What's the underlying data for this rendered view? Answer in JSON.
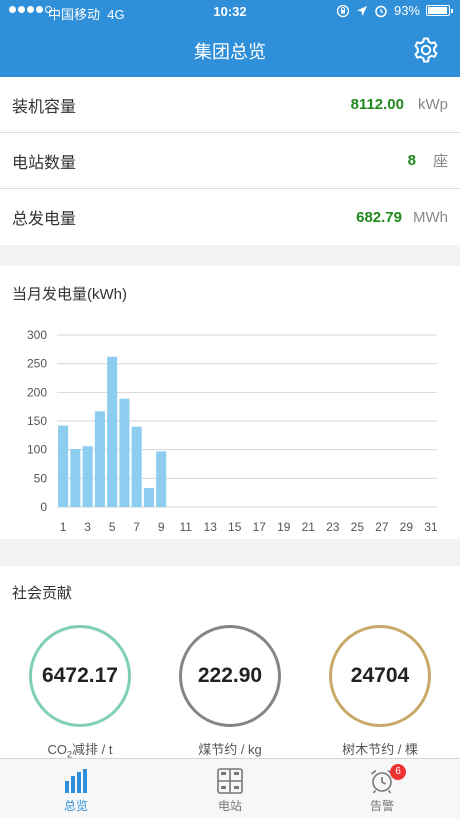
{
  "status_bar": {
    "carrier": "中国移动",
    "network": "4G",
    "time": "10:32",
    "battery": "93%",
    "battery_level": 0.93
  },
  "header": {
    "title": "集团总览"
  },
  "summary": [
    {
      "label": "装机容量",
      "value": "8112.00",
      "unit": "kWp"
    },
    {
      "label": "电站数量",
      "value": "8",
      "unit": "座"
    },
    {
      "label": "总发电量",
      "value": "682.79",
      "unit": "MWh"
    }
  ],
  "chart_card": {
    "title": "当月发电量(kWh)"
  },
  "chart_data": {
    "type": "bar",
    "title": "当月发电量(kWh)",
    "x_tick_labels": [
      "1",
      "3",
      "5",
      "7",
      "9",
      "11",
      "13",
      "15",
      "17",
      "19",
      "21",
      "23",
      "25",
      "27",
      "29",
      "31"
    ],
    "y_tick_labels": [
      "0",
      "50",
      "100",
      "150",
      "200",
      "250",
      "300"
    ],
    "ylim": [
      0,
      300
    ],
    "grid": true,
    "x": [
      1,
      2,
      3,
      4,
      5,
      6,
      7,
      8,
      9
    ],
    "values": [
      142,
      101,
      106,
      167,
      262,
      189,
      140,
      33,
      97
    ],
    "bar_color": "#8dcdf0"
  },
  "social": {
    "title": "社会贡献",
    "items": [
      {
        "value": "6472.17",
        "label_prefix": "CO",
        "label_sub": "2",
        "label_suffix": "减排 / t",
        "color": "#7fd0b0"
      },
      {
        "value": "222.90",
        "label": "煤节约 / kg",
        "color": "#858585"
      },
      {
        "value": "24704",
        "label": "树木节约 / 棵",
        "color": "#c9a86a"
      }
    ]
  },
  "tabs": [
    {
      "label": "总览",
      "icon": "bar-chart-icon",
      "active": true
    },
    {
      "label": "电站",
      "icon": "station-icon",
      "active": false
    },
    {
      "label": "告警",
      "icon": "alarm-clock-icon",
      "active": false,
      "badge": "6"
    }
  ],
  "colors": {
    "primary": "#2f8fd8",
    "value_green": "#1e8a1e"
  }
}
